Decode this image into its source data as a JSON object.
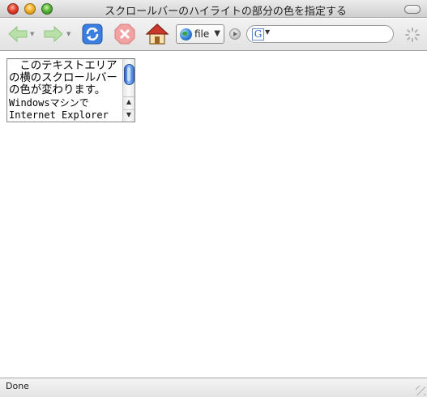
{
  "window": {
    "title": "スクロールバーのハイライトの部分の色を指定する"
  },
  "toolbar": {
    "back_icon": "back-arrow-icon",
    "forward_icon": "forward-arrow-icon",
    "reload_icon": "reload-icon",
    "stop_icon": "stop-icon",
    "home_icon": "home-icon",
    "url_value": "file",
    "search_placeholder": "",
    "search_engine_icon": "G"
  },
  "content": {
    "textarea_lines": [
      "　このテキストエリア",
      "の横のスクロールバー",
      "の色が変わります。"
    ],
    "textarea_mono_lines": [
      "Windowsマシンで",
      "Internet Explorer"
    ]
  },
  "status": {
    "text": "Done"
  },
  "colors": {
    "accent": "#2f61c9",
    "stop": "#e23c3c",
    "nav_green": "#7fcf6a"
  }
}
